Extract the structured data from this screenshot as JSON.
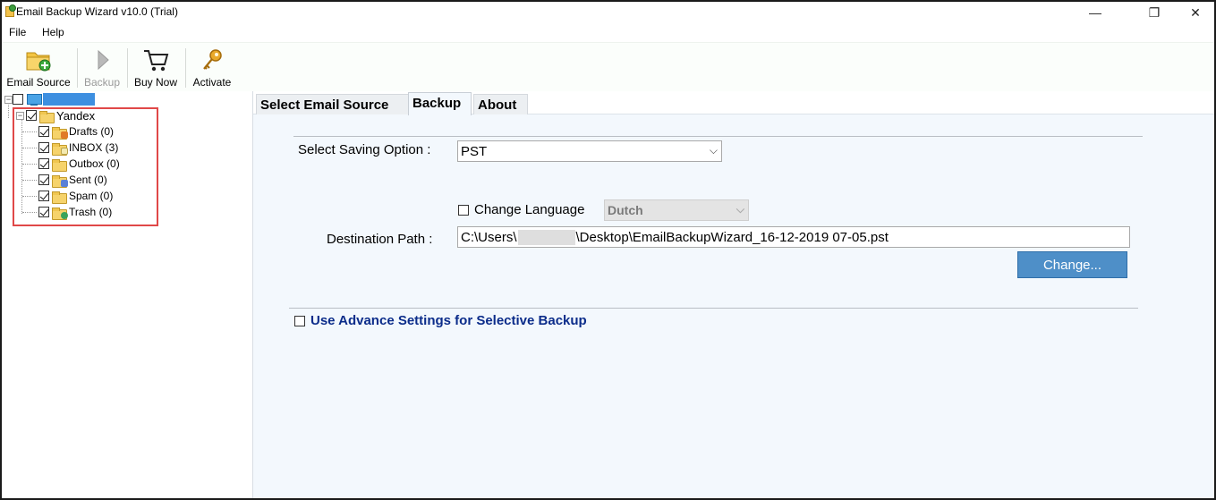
{
  "window": {
    "title": "Email Backup Wizard v10.0 (Trial)",
    "controls": {
      "minimize": "—",
      "restore": "❐",
      "close": "✕"
    }
  },
  "menu": {
    "items": [
      "File",
      "Help"
    ]
  },
  "toolbar": {
    "email_source": "Email Source",
    "backup": "Backup",
    "buy_now": "Buy Now",
    "activate": "Activate"
  },
  "tree": {
    "root_label": "",
    "account": "Yandex",
    "folders": [
      {
        "label": "Drafts (0)",
        "icon": "drafts-folder-icon",
        "checked": true
      },
      {
        "label": "INBOX (3)",
        "icon": "inbox-folder-icon",
        "checked": true
      },
      {
        "label": "Outbox (0)",
        "icon": "outbox-folder-icon",
        "checked": true
      },
      {
        "label": "Sent (0)",
        "icon": "sent-folder-icon",
        "checked": true
      },
      {
        "label": "Spam (0)",
        "icon": "spam-folder-icon",
        "checked": true
      },
      {
        "label": "Trash (0)",
        "icon": "trash-folder-icon",
        "checked": true
      }
    ]
  },
  "tabs": [
    {
      "label": "Select Email Source",
      "active": false
    },
    {
      "label": "Backup",
      "active": true
    },
    {
      "label": "About",
      "active": false
    }
  ],
  "backup": {
    "saving_option_label": "Select Saving Option :",
    "saving_option_value": "PST",
    "change_language_label": "Change Language",
    "change_language_checked": false,
    "language_value": "Dutch",
    "destination_label": "Destination Path :",
    "destination_prefix": "C:\\Users\\",
    "destination_suffix": "\\Desktop\\EmailBackupWizard_16-12-2019 07-05.pst",
    "change_button": "Change...",
    "advance_label": "Use Advance Settings for Selective Backup",
    "advance_checked": false
  },
  "colors": {
    "accent_blue": "#4e8fc8",
    "highlight_red": "#e04848",
    "link_blue": "#0b2c8a"
  }
}
